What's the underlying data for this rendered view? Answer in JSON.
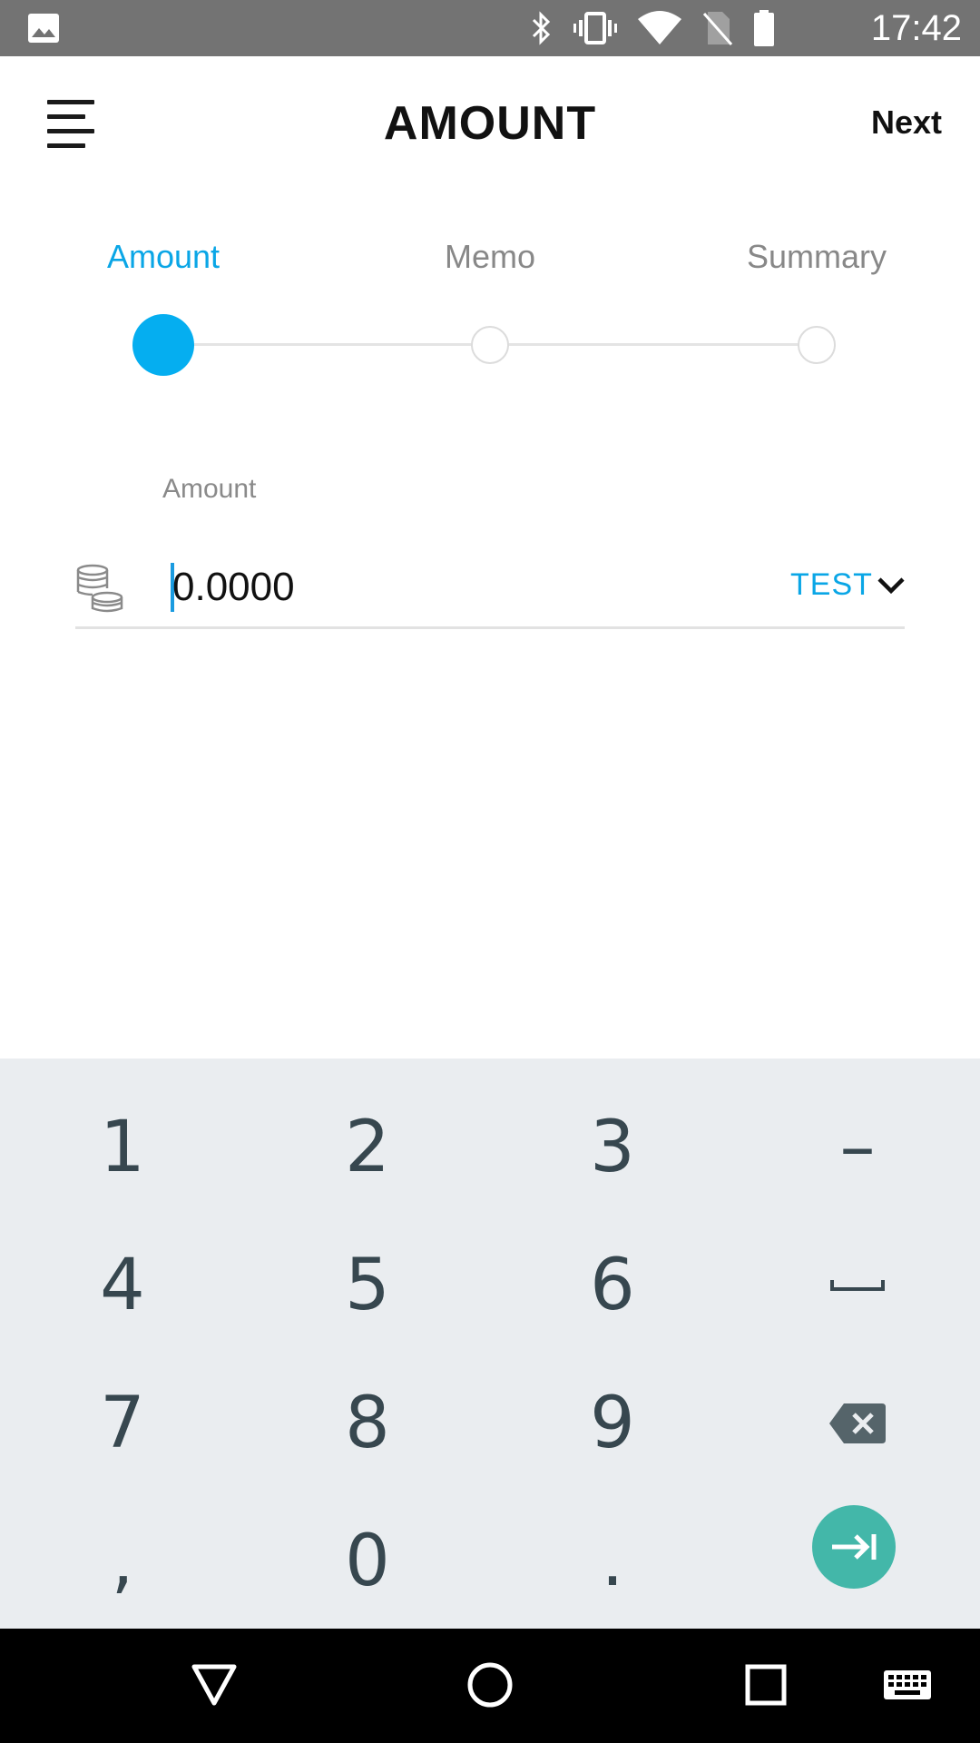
{
  "status_bar": {
    "time": "17:42",
    "icons": [
      "gallery-icon",
      "bluetooth-icon",
      "vibrate-icon",
      "wifi-icon",
      "no-sim-icon",
      "battery-icon"
    ]
  },
  "header": {
    "title": "AMOUNT",
    "next_label": "Next"
  },
  "stepper": {
    "steps": [
      {
        "label": "Amount",
        "active": true
      },
      {
        "label": "Memo",
        "active": false
      },
      {
        "label": "Summary",
        "active": false
      }
    ]
  },
  "amount_field": {
    "label": "Amount",
    "value": "0.0000",
    "currency": "TEST"
  },
  "keyboard": {
    "rows": [
      [
        "1",
        "2",
        "3",
        "–"
      ],
      [
        "4",
        "5",
        "6",
        "space"
      ],
      [
        "7",
        "8",
        "9",
        "backspace"
      ],
      [
        ",",
        "0",
        ".",
        "enter"
      ]
    ]
  },
  "colors": {
    "accent": "#05aef0",
    "accent_text": "#0aa6e6",
    "keyboard_bg": "#eaedf0",
    "enter_key": "#43b7a9",
    "status_bar": "#737373"
  }
}
